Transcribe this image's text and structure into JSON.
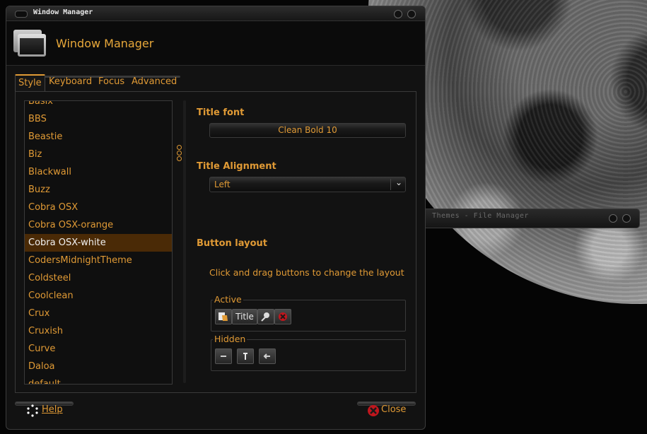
{
  "themes_window": {
    "title": "Themes - File Manager"
  },
  "window": {
    "title": "Window Manager"
  },
  "header": {
    "title": "Window Manager"
  },
  "tabs": [
    {
      "label": "Style"
    },
    {
      "label": "Keyboard"
    },
    {
      "label": "Focus"
    },
    {
      "label": "Advanced"
    }
  ],
  "theme_list": {
    "items": [
      "Basix",
      "BBS",
      "Beastie",
      "Biz",
      "Blackwall",
      "Buzz",
      "Cobra OSX",
      "Cobra OSX-orange",
      "Cobra OSX-white",
      "CodersMidnightTheme",
      "Coldsteel",
      "Coolclean",
      "Crux",
      "Cruxish",
      "Curve",
      "Daloa",
      "default"
    ],
    "selected": "Cobra OSX-white"
  },
  "style": {
    "title_font_label": "Title font",
    "title_font_value": "Clean Bold 10",
    "title_alignment_label": "Title Alignment",
    "title_alignment_value": "Left",
    "button_layout_label": "Button layout",
    "button_layout_hint": "Click and drag buttons to change the layout",
    "active_label": "Active",
    "active_title": "Title",
    "hidden_label": "Hidden"
  },
  "footer": {
    "help_label": "Help",
    "close_label": "Close"
  },
  "colors": {
    "accent": "#e09a35",
    "selection": "#4a2a06",
    "close_red": "#c0161d"
  }
}
